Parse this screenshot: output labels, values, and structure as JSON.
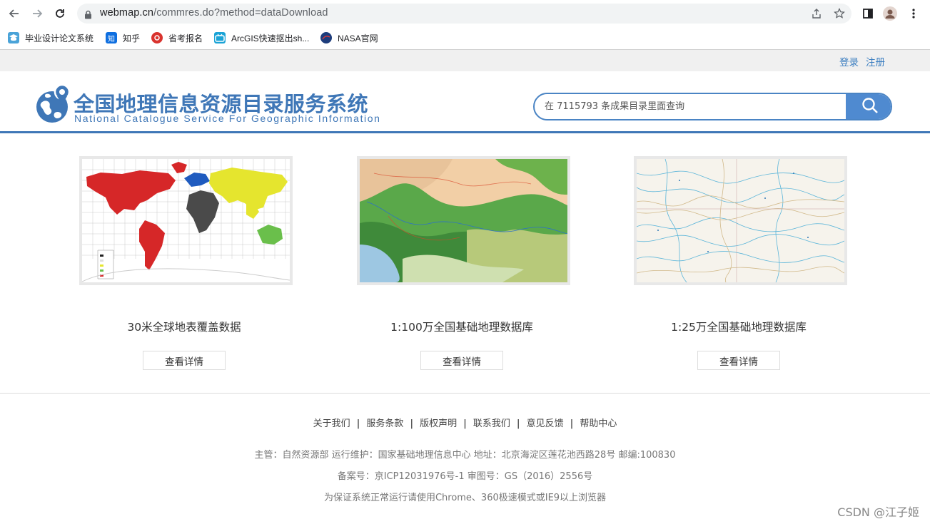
{
  "browser": {
    "url_host": "webmap.cn",
    "url_path": "/commres.do?method=dataDownload",
    "bookmarks": [
      {
        "label": "毕业设计论文系统",
        "color": "#4aa3d8",
        "glyph": "学"
      },
      {
        "label": "知乎",
        "color": "#0f6fe0",
        "glyph": "知"
      },
      {
        "label": "省考报名",
        "color": "#d9332e",
        "glyph": "省"
      },
      {
        "label": "ArcGIS快速抠出sh...",
        "color": "#1aa3d6",
        "glyph": "A"
      },
      {
        "label": "NASA官网",
        "color": "#1d3d7c",
        "glyph": "N"
      }
    ]
  },
  "topbar": {
    "login": "登录",
    "register": "注册"
  },
  "header": {
    "title": "全国地理信息资源目录服务系统",
    "subtitle": "National Catalogue Service For Geographic Information",
    "search_placeholder": "在 7115793 条成果目录里面查询"
  },
  "products": [
    {
      "title": "30米全球地表覆盖数据",
      "button": "查看详情"
    },
    {
      "title": "1:100万全国基础地理数据库",
      "button": "查看详情"
    },
    {
      "title": "1:25万全国基础地理数据库",
      "button": "查看详情"
    }
  ],
  "footer": {
    "links": [
      "关于我们",
      "服务条款",
      "版权声明",
      "联系我们",
      "意见反馈",
      "帮助中心"
    ],
    "line1": "主管：自然资源部 运行维护：国家基础地理信息中心 地址：北京海淀区莲花池西路28号 邮编:100830",
    "line2": "备案号：京ICP12031976号-1 审图号：GS（2016）2556号",
    "line3": "为保证系统正常运行请使用Chrome、360极速模式或IE9以上浏览器"
  },
  "watermark": "CSDN @江子姬",
  "colors": {
    "brand": "#3f77b7",
    "search_button": "#4f8ad0",
    "link": "#3d7fc1"
  }
}
